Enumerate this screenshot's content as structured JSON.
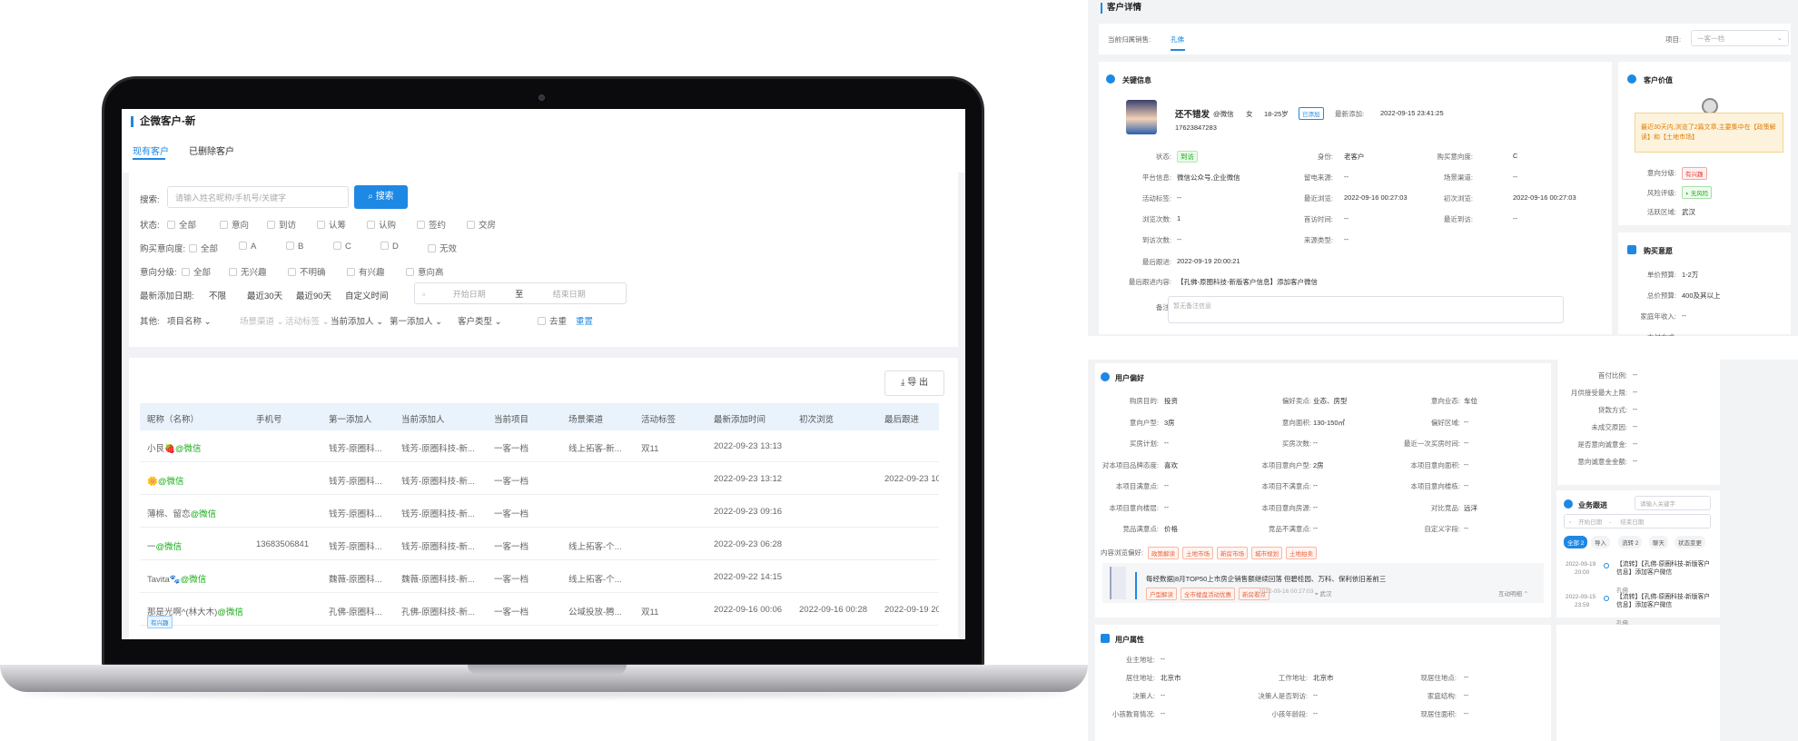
{
  "laptop": {
    "page_title": "企微客户-新",
    "tabs": [
      {
        "label": "现有客户"
      },
      {
        "label": "已删除客户"
      }
    ],
    "filters": {
      "search_label": "搜索:",
      "search_placeholder": "请输入姓名昵称/手机号/关键字",
      "search_button": "搜索",
      "status_label": "状态:",
      "status_options": [
        "全部",
        "意向",
        "到访",
        "认筹",
        "认购",
        "签约",
        "交房"
      ],
      "intent_label": "购买意向度:",
      "intent_options": [
        "全部",
        "A",
        "B",
        "C",
        "D",
        "无效"
      ],
      "grade_label": "意向分级:",
      "grade_options": [
        "全部",
        "无兴趣",
        "不明确",
        "有兴趣",
        "意向高"
      ],
      "date_label": "最新添加日期:",
      "date_options": [
        "不限",
        "最近30天",
        "最近90天",
        "自定义时间"
      ],
      "date_start": "开始日期",
      "date_sep": "至",
      "date_end": "结束日期",
      "other_label": "其他:",
      "other_selects": [
        "项目名称",
        "场景渠道",
        "活动标签",
        "当前添加人",
        "第一添加人",
        "客户类型"
      ],
      "dedupe": "去重",
      "reset": "重置"
    },
    "export_button": "导 出",
    "table": {
      "columns": [
        "昵称（名称）",
        "手机号",
        "第一添加人",
        "当前添加人",
        "当前项目",
        "场景渠道",
        "活动标签",
        "最新添加时间",
        "初次浏览",
        "最后跟进"
      ],
      "rows": [
        {
          "name": "小艮🍓",
          "wx": "@微信",
          "phone": "",
          "first": "钱芳-原圈科...",
          "current": "钱芳-原圈科技-新...",
          "project": "一客一档",
          "channel": "线上拓客-新...",
          "tag": "双11",
          "added": "2022-09-23 13:13",
          "first_view": "",
          "last": ""
        },
        {
          "name": "🌼",
          "wx": "@微信",
          "phone": "",
          "first": "钱芳-原圈科...",
          "current": "钱芳-原圈科技-新...",
          "project": "一客一档",
          "channel": "",
          "tag": "",
          "added": "2022-09-23 13:12",
          "first_view": "",
          "last": "2022-09-23 10:1"
        },
        {
          "name": "薄棉、留恋",
          "wx": "@微信",
          "phone": "",
          "first": "钱芳-原圈科...",
          "current": "钱芳-原圈科技-新...",
          "project": "一客一档",
          "channel": "",
          "tag": "",
          "added": "2022-09-23 09:16",
          "first_view": "",
          "last": ""
        },
        {
          "name": "一",
          "wx": "@微信",
          "phone": "13683506841",
          "first": "钱芳-原圈科...",
          "current": "钱芳-原圈科技-新...",
          "project": "一客一档",
          "channel": "线上拓客-个...",
          "tag": "",
          "added": "2022-09-23 06:28",
          "first_view": "",
          "last": ""
        },
        {
          "name": "Tavita🐾",
          "wx": "@微信",
          "phone": "",
          "first": "魏薇-原圈科...",
          "current": "魏薇-原圈科技-新...",
          "project": "一客一档",
          "channel": "线上拓客-个...",
          "tag": "",
          "added": "2022-09-22 14:15",
          "first_view": "",
          "last": ""
        },
        {
          "name": "那是光啊^(林大木)",
          "wx": "@微信",
          "phone": "",
          "first": "孔佛-原圈科...",
          "current": "孔佛-原圈科技-新...",
          "project": "一客一档",
          "channel": "公域投放-腾...",
          "tag": "双11",
          "added": "2022-09-16 00:06",
          "first_view": "2022-09-16 00:28",
          "last": "2022-09-19 20:0"
        }
      ],
      "row_badge": "有兴趣"
    }
  },
  "detail": {
    "title": "客户详情",
    "owner_label": "当前归属销售:",
    "owner_value": "孔佛",
    "project_label": "项目:",
    "project_value": "一客一档",
    "key_info_title": "关键信息",
    "customer": {
      "name": "还不错发",
      "wx": "@微信",
      "gender": "女",
      "age": "18-25岁",
      "added_badge": "已添加",
      "latest_add_label": "最新添加:",
      "latest_add": "2022-09-15 23:41:25",
      "phone": "17623847283"
    },
    "fields": [
      {
        "k": "状态:",
        "v": "到访",
        "tag": true
      },
      {
        "k": "身份:",
        "v": "老客户"
      },
      {
        "k": "购买意向度:",
        "v": "C"
      },
      {
        "k": "平台信息:",
        "v": "微信公众号,企业微信"
      },
      {
        "k": "留电来源:",
        "v": "--"
      },
      {
        "k": "场景渠道:",
        "v": "--"
      },
      {
        "k": "活动标签:",
        "v": "--"
      },
      {
        "k": "最近浏览:",
        "v": "2022-09-16 00:27:03"
      },
      {
        "k": "初次浏览:",
        "v": "2022-09-16 00:27:03"
      },
      {
        "k": "浏览次数:",
        "v": "1"
      },
      {
        "k": "首访时间:",
        "v": "--"
      },
      {
        "k": "最近到访:",
        "v": "--"
      },
      {
        "k": "到访次数:",
        "v": "--"
      },
      {
        "k": "来源类型:",
        "v": "--"
      }
    ],
    "last_follow_label": "最后跟进:",
    "last_follow": "2022-09-19 20:00:21",
    "last_follow_content_label": "最后跟进内容:",
    "last_follow_content": "【孔佛-原圈科技-新版客户信息】添加客户微信",
    "remark_label": "备注:",
    "remark_placeholder": "暂无备注信息",
    "value": {
      "title": "客户价值",
      "note": "最近30天内,浏览了2篇文章,主要集中在【政策解读】和【土地市场】",
      "grade_label": "意向分级:",
      "grade": "有兴趣",
      "risk_label": "风险评级:",
      "risk": "无风险",
      "area_label": "活跃区域:",
      "area": "武汉"
    },
    "intent": {
      "title": "购买意愿",
      "rows": [
        {
          "k": "单价预算:",
          "v": "1-2万"
        },
        {
          "k": "总价预算:",
          "v": "400及其以上"
        },
        {
          "k": "家庭年收入:",
          "v": "--"
        },
        {
          "k": "支付方式:",
          "v": "--"
        }
      ]
    },
    "intent_more": [
      {
        "k": "首付比例:",
        "v": "--"
      },
      {
        "k": "月供接受最大上限:",
        "v": "--"
      },
      {
        "k": "贷款方式:",
        "v": "--"
      },
      {
        "k": "未成交原因:",
        "v": "--"
      },
      {
        "k": "是否意向诚意金:",
        "v": "--"
      },
      {
        "k": "意向诚意金金额:",
        "v": "--"
      }
    ],
    "pref": {
      "title": "用户偏好",
      "rows": [
        [
          {
            "k": "购房目的:",
            "v": "投资"
          },
          {
            "k": "偏好卖点:",
            "v": "业态、房型"
          },
          {
            "k": "意向业态:",
            "v": "车位"
          }
        ],
        [
          {
            "k": "意向户型:",
            "v": "3房"
          },
          {
            "k": "意向面积:",
            "v": "130-150㎡"
          },
          {
            "k": "偏好区域:",
            "v": "--"
          }
        ],
        [
          {
            "k": "买房计划:",
            "v": "--"
          },
          {
            "k": "买房次数:",
            "v": "--"
          },
          {
            "k": "最近一次买房时间:",
            "v": "--"
          }
        ],
        [
          {
            "k": "对本项目品牌态度:",
            "v": "喜欢"
          },
          {
            "k": "本项目意向户型:",
            "v": "2房"
          },
          {
            "k": "本项目意向面积:",
            "v": "--"
          }
        ],
        [
          {
            "k": "本项目满意点:",
            "v": "--"
          },
          {
            "k": "本项目不满意点:",
            "v": "--"
          },
          {
            "k": "本项目意向楼栋:",
            "v": "--"
          }
        ],
        [
          {
            "k": "本项目意向楼层:",
            "v": "--"
          },
          {
            "k": "本项目意向房源:",
            "v": "--"
          },
          {
            "k": "对比竞品:",
            "v": "远洋"
          }
        ],
        [
          {
            "k": "竞品满意点:",
            "v": "价格"
          },
          {
            "k": "竞品不满意点:",
            "v": "--"
          },
          {
            "k": "自定义字段:",
            "v": "--"
          }
        ]
      ],
      "content_label": "内容浏览偏好:",
      "content_tags": [
        "政策解读",
        "土地市场",
        "新房市场",
        "城市规划",
        "土地拍卖"
      ],
      "article_title": "每经数据|8月TOP50上市房企销售额继续回落 但碧桂园、万科、保利依旧差前三",
      "article_tags": [
        "户型解读",
        "全市楼盘活动优惠",
        "新房看点"
      ],
      "article_time": "2022-09-16 00:27:03",
      "article_city": "武汉",
      "article_toggle": "互动明细"
    },
    "attr": {
      "title": "用户属性",
      "rows": [
        [
          {
            "k": "业主地址:",
            "v": "--"
          }
        ],
        [
          {
            "k": "居住地址:",
            "v": "北京市"
          },
          {
            "k": "工作地址:",
            "v": "北京市"
          },
          {
            "k": "现居住地点:",
            "v": "--"
          }
        ],
        [
          {
            "k": "决策人:",
            "v": "--"
          },
          {
            "k": "决策人是否到访:",
            "v": "--"
          },
          {
            "k": "家庭结构:",
            "v": "--"
          }
        ],
        [
          {
            "k": "小孩教育情况:",
            "v": "--"
          },
          {
            "k": "小孩年龄段:",
            "v": "--"
          },
          {
            "k": "现居住面积:",
            "v": "--"
          }
        ]
      ]
    },
    "follow": {
      "title": "业务跟进",
      "search_placeholder": "请输入关键字",
      "start": "开始日期",
      "end": "结束日期",
      "chips": [
        "全部 2",
        "导入",
        "流转 2",
        "聊天",
        "状态变更"
      ],
      "items": [
        {
          "date": "2022-09-19",
          "time": "20:00",
          "text": "【流转】【孔佛-原圈科技-新版客户信息】添加客户微信",
          "user": "孔佛"
        },
        {
          "date": "2022-09-15",
          "time": "23:59",
          "text": "【流转】【孔佛-原圈科技-新版客户信息】添加客户微信",
          "user": "孔佛"
        }
      ]
    }
  }
}
